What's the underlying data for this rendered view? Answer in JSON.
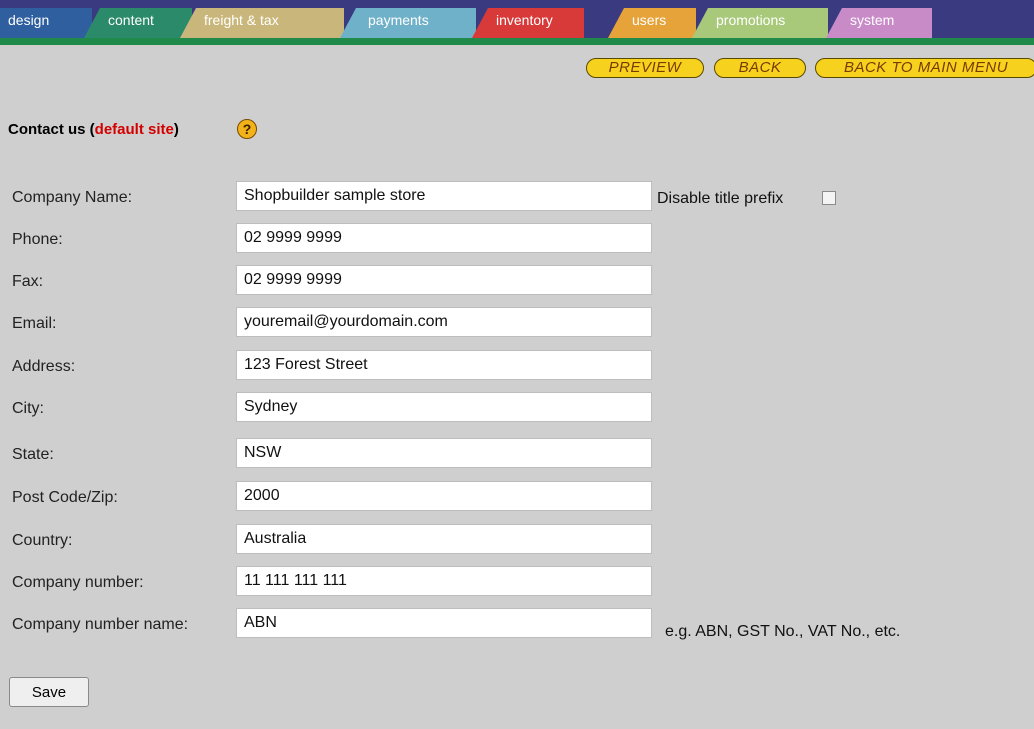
{
  "tabs": [
    {
      "label": "design",
      "color": "#2f5f9e",
      "active": false
    },
    {
      "label": "content",
      "color": "#2b8a6a",
      "active": true
    },
    {
      "label": "freight & tax",
      "color": "#c9b67a",
      "active": false
    },
    {
      "label": "payments",
      "color": "#6fb1c9",
      "active": false
    },
    {
      "label": "inventory",
      "color": "#d83a3a",
      "active": false
    },
    {
      "label": "users",
      "color": "#e6a33a",
      "active": false
    },
    {
      "label": "promotions",
      "color": "#a8c87a",
      "active": false
    },
    {
      "label": "system",
      "color": "#c88bc8",
      "active": false
    }
  ],
  "actions": {
    "preview": "PREVIEW",
    "back": "BACK",
    "main_menu": "BACK TO MAIN MENU"
  },
  "heading": {
    "prefix": "Contact us (",
    "site": "default site",
    "suffix": ")"
  },
  "help_icon": "?",
  "fields": {
    "company_name": {
      "label": "Company Name:",
      "value": "Shopbuilder sample store"
    },
    "phone": {
      "label": "Phone:",
      "value": "02 9999 9999"
    },
    "fax": {
      "label": "Fax:",
      "value": "02 9999 9999"
    },
    "email": {
      "label": "Email:",
      "value": "youremail@yourdomain.com"
    },
    "address": {
      "label": "Address:",
      "value": "123 Forest Street"
    },
    "city": {
      "label": "City:",
      "value": "Sydney"
    },
    "state": {
      "label": "State:",
      "value": "NSW"
    },
    "postcode": {
      "label": "Post Code/Zip:",
      "value": "2000"
    },
    "country": {
      "label": "Country:",
      "value": "Australia"
    },
    "company_number": {
      "label": "Company number:",
      "value": "11 111 111 111"
    },
    "company_number_name": {
      "label": "Company number name:",
      "value": "ABN"
    }
  },
  "disable_title_prefix": {
    "label": "Disable title prefix",
    "checked": false
  },
  "company_number_hint": "e.g. ABN, GST No., VAT No., etc.",
  "save_label": "Save"
}
